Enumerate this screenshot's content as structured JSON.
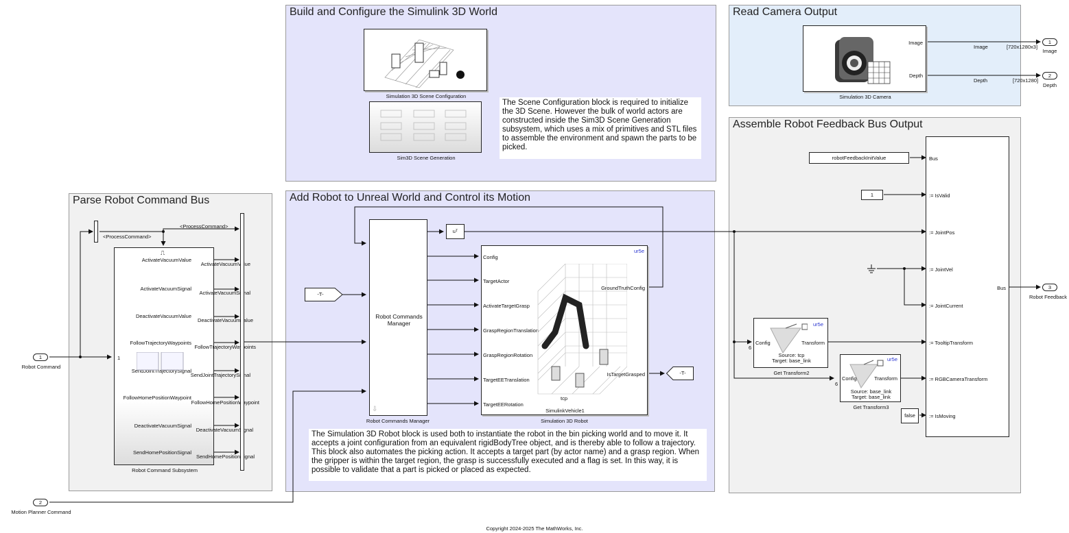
{
  "areas": {
    "build": "Build and Configure the Simulink 3D World",
    "camera": "Read Camera Output",
    "assemble": "Assemble Robot Feedback Bus Output",
    "parse": "Parse Robot Command Bus",
    "add_robot": "Add Robot to Unreal World and Control its Motion"
  },
  "notes": {
    "scene": "The Scene Configuration block is required to initialize the 3D Scene. However the bulk of world actors are constructed inside the Sim3D Scene Generation subsystem, which uses a mix of primitives and STL files to assemble the environment and spawn the parts to be picked.",
    "robot": "The Simulation 3D Robot block is used both to instantiate the robot in the bin picking world and to move it. It accepts a joint configuration from an equivalent rigidBodyTree object, and is thereby able to follow a trajectory. This block also automates the picking action. It accepts a target part (by actor name) and a grasp region. When the gripper is within the target region, the grasp is successfully executed and a flag is set. In this way, it is possible to validate that a part is picked or placed as expected."
  },
  "blocks": {
    "scene_config": "Simulation 3D Scene Configuration",
    "scene_gen": "Sim3D Scene Generation",
    "camera": "Simulation 3D Camera",
    "camera_image_port": "Image",
    "camera_depth_port": "Depth",
    "rcm_label": "Robot Commands Manager",
    "rcm_caption": "Robot Commands Manager",
    "sim_robot_caption": "Simulation 3D Robot",
    "sim_robot_vehicle": "SimulinkVehicle1",
    "sim_robot_tcp": "tcp",
    "sim_robot_model": "ur5e",
    "sim_robot_out1": "GroundTruthConfig",
    "sim_robot_out2": "IsTargetGrasped",
    "sim_robot_inputs": [
      "Config",
      "TargetActor",
      "ActivateTargetGrasp",
      "GraspRegionTranslation",
      "GraspRegionRotation",
      "TargetEETranslation",
      "TargetEERotation"
    ],
    "transpose": "uᵀ",
    "goto_tag": "-T-",
    "from_tag": "-T-",
    "subsystem_caption": "Robot Command Subsystem",
    "subsystem_in_port": "1",
    "subsystem_trigger": "⎍",
    "subsystem_outputs": [
      "ActivateVacuumValue",
      "ActivateVacuumSignal",
      "DeactivateVacuumValue",
      "FollowTrajectoryWaypoints",
      "SendJointTrajectorySignal",
      "FollowHomePositionWaypoint",
      "DeactivateVacuumSignal",
      "SendHomePositionSignal"
    ],
    "selector_label": "<ProcessCommand>",
    "selector_top_label": "<ProcessCommand>",
    "get_transform2": {
      "caption": "Get Transform2",
      "model": "ur5e",
      "in_port": "Config",
      "out_port": "Transform",
      "source": "Source: tcp",
      "target": "Target: base_link",
      "dim": "6"
    },
    "get_transform3": {
      "caption": "Get Transform3",
      "model": "ur5e",
      "in_port": "Config",
      "out_port": "Transform",
      "source": "Source: base_link",
      "target": "Target: base_link",
      "dim": "6"
    },
    "init_value": "robotFeedbackInitValue",
    "const_one": "1",
    "const_false": "false",
    "bus_assign_inputs": [
      "Bus",
      ":= IsValid",
      ":= JointPos",
      ":= JointVel",
      ":= JointCurrent",
      ":= TooltipTransform",
      ":= RGBCameraTransform",
      ":= IsMoving"
    ],
    "bus_assign_out": "Bus"
  },
  "ports": {
    "in1": {
      "num": "1",
      "label": "Robot Command"
    },
    "in2": {
      "num": "2",
      "label": "Motion Planner Command"
    },
    "out1": {
      "num": "1",
      "label": "Image",
      "wire": "Image",
      "dims": "[720x1280x3]"
    },
    "out2": {
      "num": "2",
      "label": "Depth",
      "wire": "Depth",
      "dims": "[720x1280]"
    },
    "out3": {
      "num": "3",
      "label": "Robot Feedback"
    }
  },
  "footer": "Copyright 2024-2025 The MathWorks, Inc."
}
